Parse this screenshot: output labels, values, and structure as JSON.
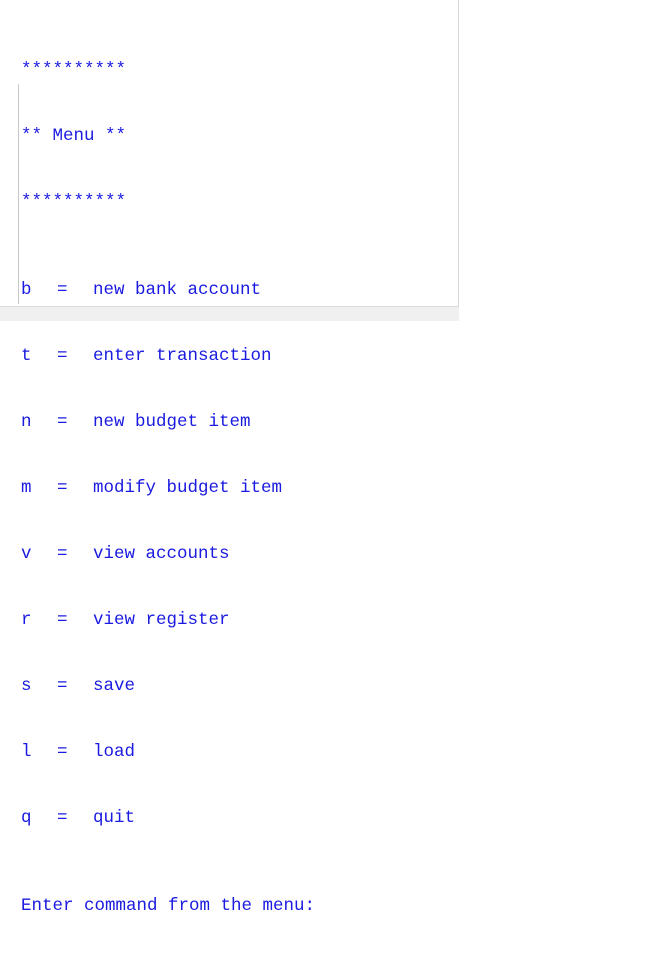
{
  "header": {
    "stars_top": "**********",
    "title": "** Menu **",
    "stars_bottom": "**********"
  },
  "menu": {
    "items": [
      {
        "key": "b",
        "sep": "=",
        "label": "new bank account"
      },
      {
        "key": "t",
        "sep": "=",
        "label": "enter transaction"
      },
      {
        "key": "n",
        "sep": "=",
        "label": "new budget item"
      },
      {
        "key": "m",
        "sep": "=",
        "label": "modify budget item"
      },
      {
        "key": "v",
        "sep": "=",
        "label": "view accounts"
      },
      {
        "key": "r",
        "sep": "=",
        "label": "view register"
      },
      {
        "key": "s",
        "sep": "=",
        "label": "save"
      },
      {
        "key": "l",
        "sep": "=",
        "label": "load"
      },
      {
        "key": "q",
        "sep": "=",
        "label": "quit"
      }
    ]
  },
  "prompt": {
    "text": "Enter command from the menu:"
  },
  "colors": {
    "text": "#1a1ae0",
    "background": "#ffffff",
    "scrollbar": "#f0f0f0"
  }
}
